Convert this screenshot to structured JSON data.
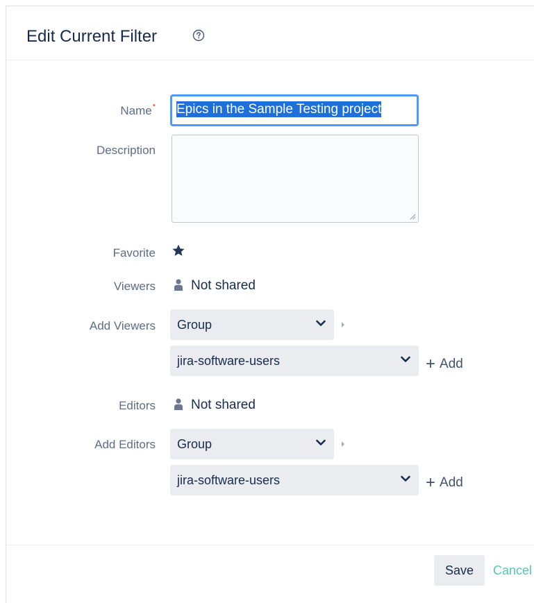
{
  "dialog": {
    "title": "Edit Current Filter"
  },
  "form": {
    "name": {
      "label": "Name",
      "required_mark": "*",
      "value": "Epics in the Sample Testing project"
    },
    "description": {
      "label": "Description",
      "value": ""
    },
    "favorite": {
      "label": "Favorite",
      "starred": true
    },
    "viewers": {
      "label": "Viewers",
      "value": "Not shared"
    },
    "add_viewers": {
      "label": "Add Viewers",
      "type_select": "Group",
      "group_select": "jira-software-users",
      "add_label": "Add"
    },
    "editors": {
      "label": "Editors",
      "value": "Not shared"
    },
    "add_editors": {
      "label": "Add Editors",
      "type_select": "Group",
      "group_select": "jira-software-users",
      "add_label": "Add"
    }
  },
  "footer": {
    "save_label": "Save",
    "cancel_label": "Cancel"
  },
  "colors": {
    "accent_focus": "#4c9aff",
    "selection": "#1e6fd9",
    "cancel_link": "#57c7b4",
    "required": "#de350b"
  }
}
